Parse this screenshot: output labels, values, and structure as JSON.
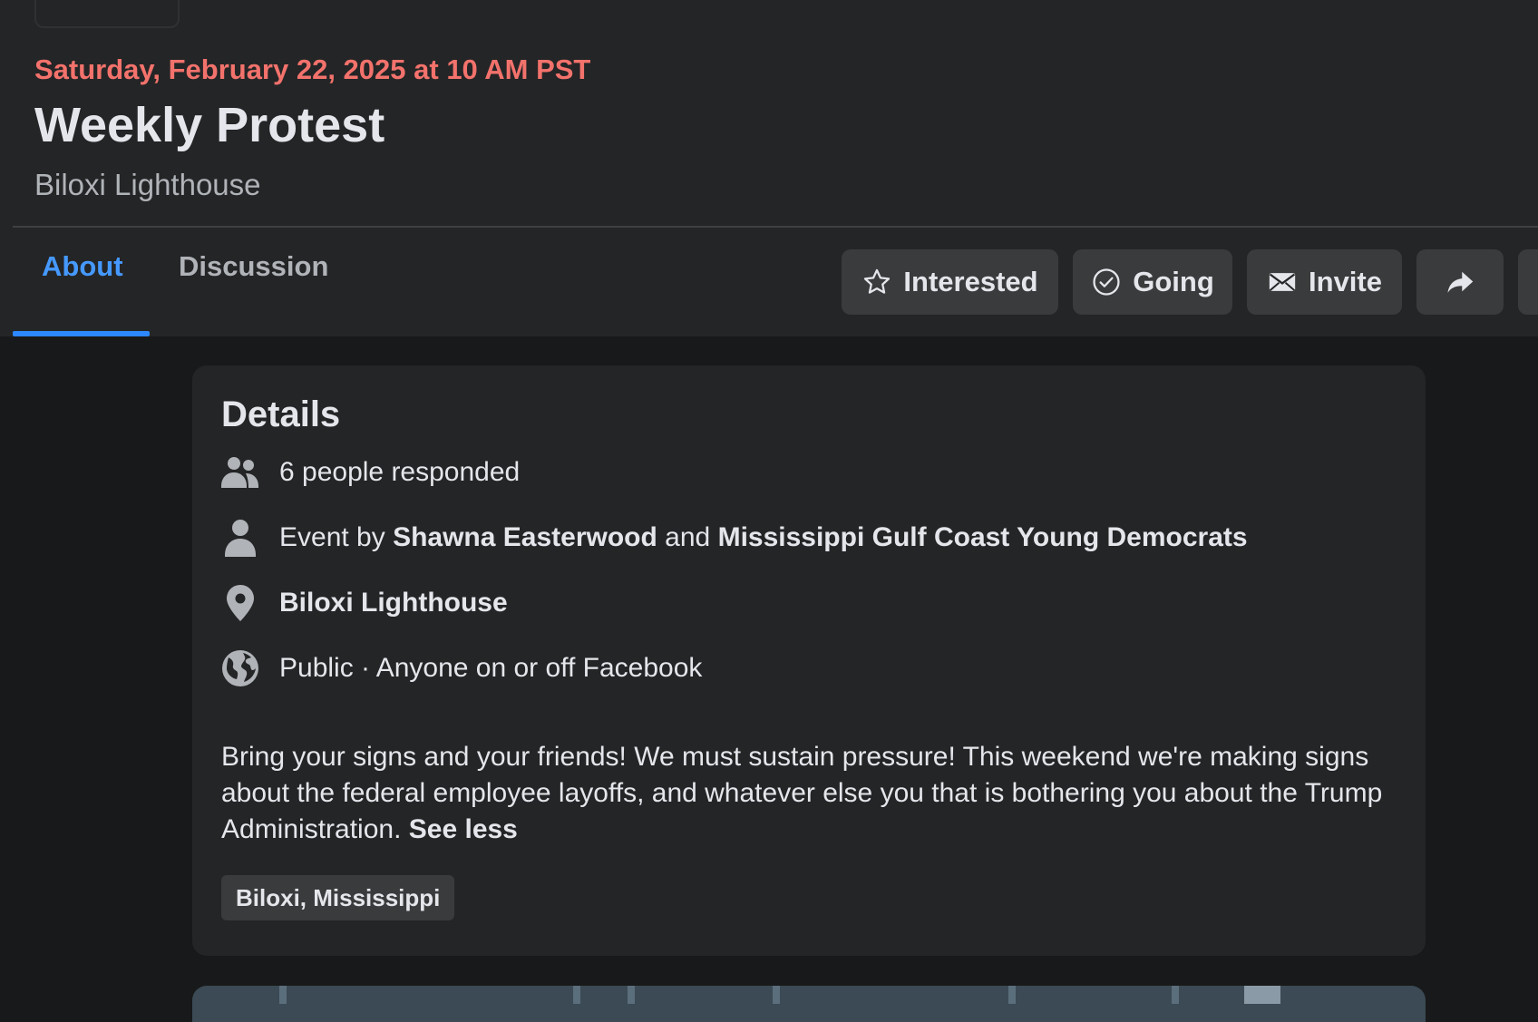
{
  "event": {
    "date": "Saturday, February 22, 2025 at 10 AM PST",
    "title": "Weekly Protest",
    "location": "Biloxi Lighthouse"
  },
  "tabs": [
    {
      "label": "About",
      "active": true
    },
    {
      "label": "Discussion",
      "active": false
    }
  ],
  "actions": {
    "interested": "Interested",
    "going": "Going",
    "invite": "Invite",
    "share_icon": "share-arrow-icon"
  },
  "details": {
    "heading": "Details",
    "responded": "6 people responded",
    "event_by_prefix": "Event by",
    "host_1": "Shawna Easterwood",
    "and": "and",
    "host_2": "Mississippi Gulf Coast Young Democrats",
    "place": "Biloxi Lighthouse",
    "privacy": "Public · Anyone on or off Facebook",
    "description": "Bring your signs and your friends! We must sustain pressure! This weekend we're making signs about the federal employee layoffs, and whatever else you that is bothering you about the Trump Administration.",
    "see_less": "See less",
    "city_chip": "Biloxi, Mississippi"
  },
  "icons": {
    "people": "people-icon",
    "person": "person-icon",
    "pin": "location-pin-icon",
    "globe": "globe-icon",
    "star": "star-icon",
    "check": "check-circle-icon",
    "envelope": "envelope-icon"
  },
  "colors": {
    "date": "#f3726c",
    "active_tab": "#4599ff",
    "tab_underline": "#2d88ff",
    "panel": "#242526",
    "page": "#18191a",
    "button": "#3a3b3c"
  }
}
